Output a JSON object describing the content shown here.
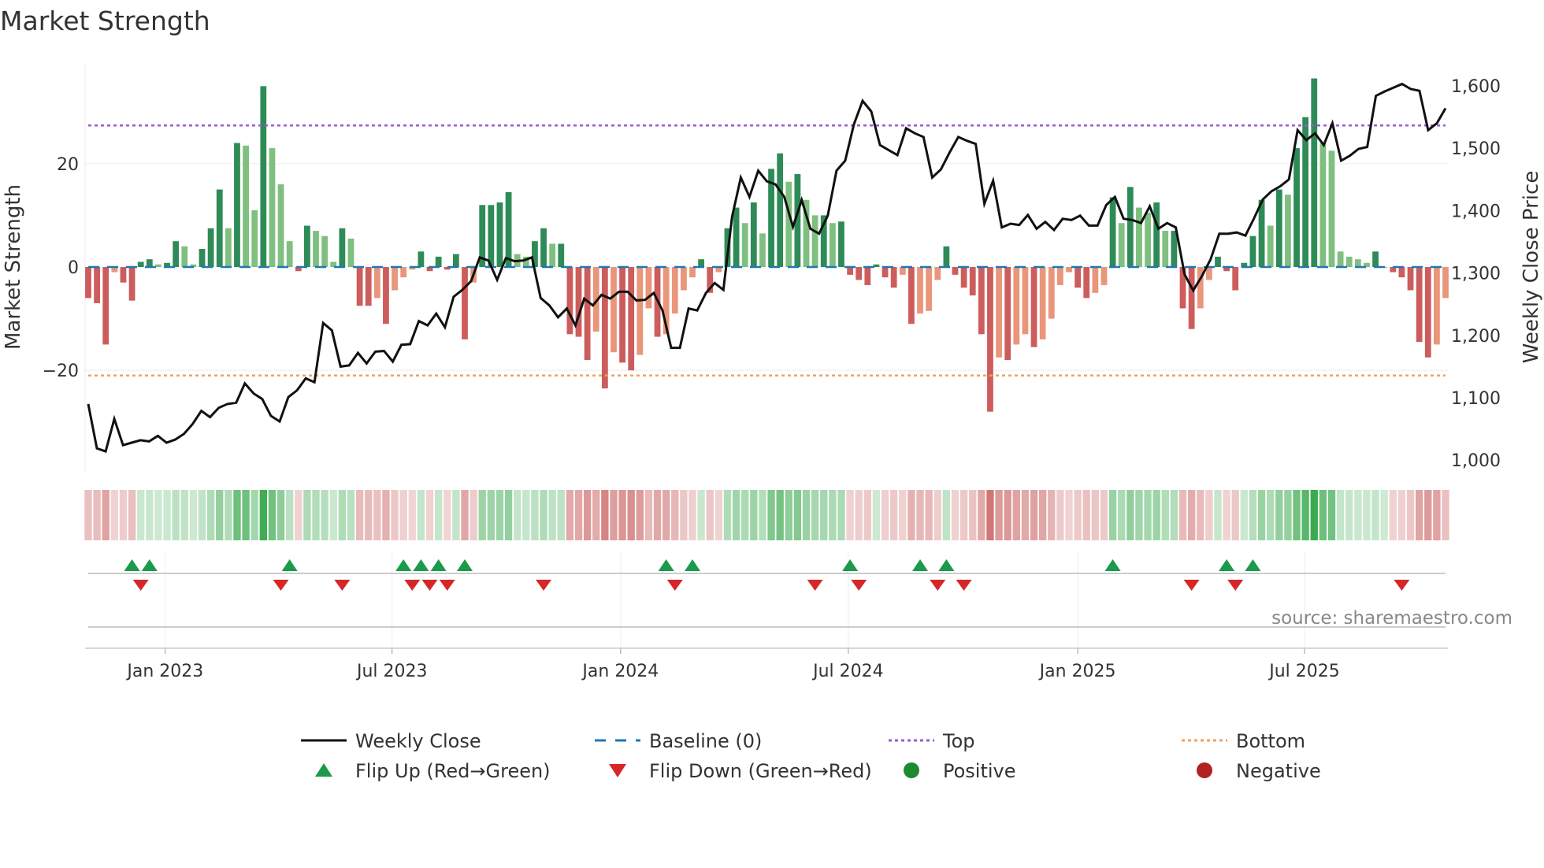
{
  "chart_data": {
    "type": "bar",
    "title": "Market Strength",
    "ylabel": "Market Strength",
    "y2label": "Weekly Close Price",
    "ylim": [
      -39,
      40
    ],
    "y2lim": [
      1000,
      1600
    ],
    "yticks": [
      "20",
      "0",
      "−20"
    ],
    "ytick_values": [
      20,
      0,
      -20
    ],
    "y2ticks": [
      "1,600",
      "1,500",
      "1,400",
      "1,300",
      "1,200",
      "1,100",
      "1,000"
    ],
    "y2tick_values": [
      1600,
      1500,
      1400,
      1300,
      1200,
      1100,
      1000
    ],
    "top_level": 27.4,
    "bottom_level": -21,
    "xticks": [
      {
        "label": "Jan 2023",
        "index": 8.8
      },
      {
        "label": "Jul 2023",
        "index": 34.7
      },
      {
        "label": "Jan 2024",
        "index": 60.8
      },
      {
        "label": "Jul 2024",
        "index": 86.8
      },
      {
        "label": "Jan 2025",
        "index": 113.0
      },
      {
        "label": "Jul 2025",
        "index": 138.9
      }
    ],
    "strength": [
      -6,
      -7,
      -15,
      -1,
      -3,
      -6.5,
      1,
      1.5,
      0.5,
      0.8,
      5,
      4,
      0.5,
      3.5,
      7.5,
      15,
      7.5,
      24,
      23.5,
      11,
      35,
      23,
      16,
      5,
      -0.8,
      8,
      7,
      6,
      1,
      7.5,
      5.5,
      -7.5,
      -7.5,
      -6,
      -11,
      -4.5,
      -2,
      -0.5,
      3,
      -0.8,
      2,
      -0.5,
      2.5,
      -14,
      -3,
      12,
      12,
      12.5,
      14.5,
      2.5,
      2,
      5,
      7.5,
      4.5,
      4.5,
      -13,
      -13.5,
      -18,
      -12.5,
      -23.5,
      -16.5,
      -18.5,
      -20,
      -17,
      -8,
      -13.5,
      -13,
      -9,
      -4.5,
      -2,
      1.5,
      -5,
      -1,
      7.5,
      11.5,
      8.5,
      12.5,
      6.5,
      19,
      22,
      16.5,
      18,
      13,
      10,
      10,
      8.5,
      8.8,
      -1.5,
      -2.5,
      -3.5,
      0.5,
      -2,
      -4,
      -1.5,
      -11,
      -9,
      -8.5,
      -2.5,
      4,
      -1.5,
      -4,
      -5.5,
      -13,
      -28,
      -17.5,
      -18,
      -15,
      -13,
      -15.5,
      -14,
      -10,
      -3.5,
      -1,
      -4,
      -6,
      -5,
      -3.5,
      13.5,
      8.5,
      15.5,
      11.5,
      10.5,
      12.5,
      7,
      7,
      -8,
      -12,
      -8,
      -2.5,
      2,
      -0.8,
      -4.5,
      0.8,
      6,
      13,
      8,
      15,
      14,
      23,
      29,
      36.5,
      24,
      22.5,
      3,
      2,
      1.5,
      0.8,
      3,
      0,
      -1,
      -2,
      -4.5,
      -14.5,
      -17.5,
      -15,
      -6
    ],
    "weekly_close": [
      1090,
      1019,
      1014,
      1066,
      1024,
      1028,
      1032,
      1030,
      1039,
      1028,
      1033,
      1042,
      1058,
      1079,
      1069,
      1084,
      1090,
      1092,
      1123,
      1107,
      1098,
      1071,
      1062,
      1101,
      1112,
      1131,
      1125,
      1220,
      1208,
      1150,
      1152,
      1172,
      1155,
      1174,
      1175,
      1158,
      1185,
      1186,
      1223,
      1216,
      1235,
      1213,
      1262,
      1273,
      1287,
      1325,
      1320,
      1289,
      1324,
      1319,
      1320,
      1325,
      1260,
      1248,
      1229,
      1243,
      1216,
      1259,
      1248,
      1265,
      1259,
      1270,
      1270,
      1256,
      1257,
      1268,
      1240,
      1180,
      1180,
      1243,
      1240,
      1268,
      1284,
      1273,
      1390,
      1453,
      1422,
      1464,
      1447,
      1442,
      1422,
      1374,
      1417,
      1371,
      1363,
      1392,
      1464,
      1480,
      1538,
      1576,
      1559,
      1505,
      1497,
      1489,
      1532,
      1524,
      1518,
      1453,
      1466,
      1493,
      1518,
      1512,
      1507,
      1411,
      1448,
      1373,
      1379,
      1377,
      1393,
      1371,
      1382,
      1369,
      1387,
      1385,
      1392,
      1376,
      1376,
      1409,
      1422,
      1387,
      1385,
      1380,
      1407,
      1371,
      1380,
      1373,
      1298,
      1272,
      1295,
      1322,
      1363,
      1363,
      1365,
      1360,
      1388,
      1418,
      1431,
      1439,
      1450,
      1529,
      1513,
      1524,
      1505,
      1540,
      1480,
      1488,
      1499,
      1502,
      1584,
      1591,
      1597,
      1603,
      1595,
      1592,
      1529,
      1540,
      1564
    ],
    "flip_up_index": [
      5,
      7,
      23,
      36,
      38,
      40,
      43,
      66,
      69,
      87,
      95,
      98,
      117,
      130,
      133
    ],
    "flip_down_index": [
      6,
      22,
      29,
      37,
      39,
      41,
      52,
      67,
      83,
      88,
      97,
      100,
      126,
      131,
      150
    ],
    "legend": [
      {
        "label": "Weekly Close",
        "kind": "line",
        "color": "#111111"
      },
      {
        "label": "Baseline (0)",
        "kind": "dash",
        "color": "#1f77b4"
      },
      {
        "label": "Top",
        "kind": "dot",
        "color": "#9b59d6"
      },
      {
        "label": "Bottom",
        "kind": "dot",
        "color": "#f0a060"
      },
      {
        "label": "Flip Up (Red→Green)",
        "kind": "up",
        "color": "#1a9a4a"
      },
      {
        "label": "Flip Down (Green→Red)",
        "kind": "down",
        "color": "#d62728"
      },
      {
        "label": "Positive",
        "kind": "circle",
        "color": "#1e8a2e"
      },
      {
        "label": "Negative",
        "kind": "circle",
        "color": "#b22222"
      }
    ],
    "legend_placement": "bottom",
    "source": "source: sharemaestro.com",
    "colors": {
      "green_dark": "#2e8b57",
      "green_light": "#7fbf7f",
      "red_dark": "#cd5c5c",
      "red_light": "#e9967a"
    }
  }
}
